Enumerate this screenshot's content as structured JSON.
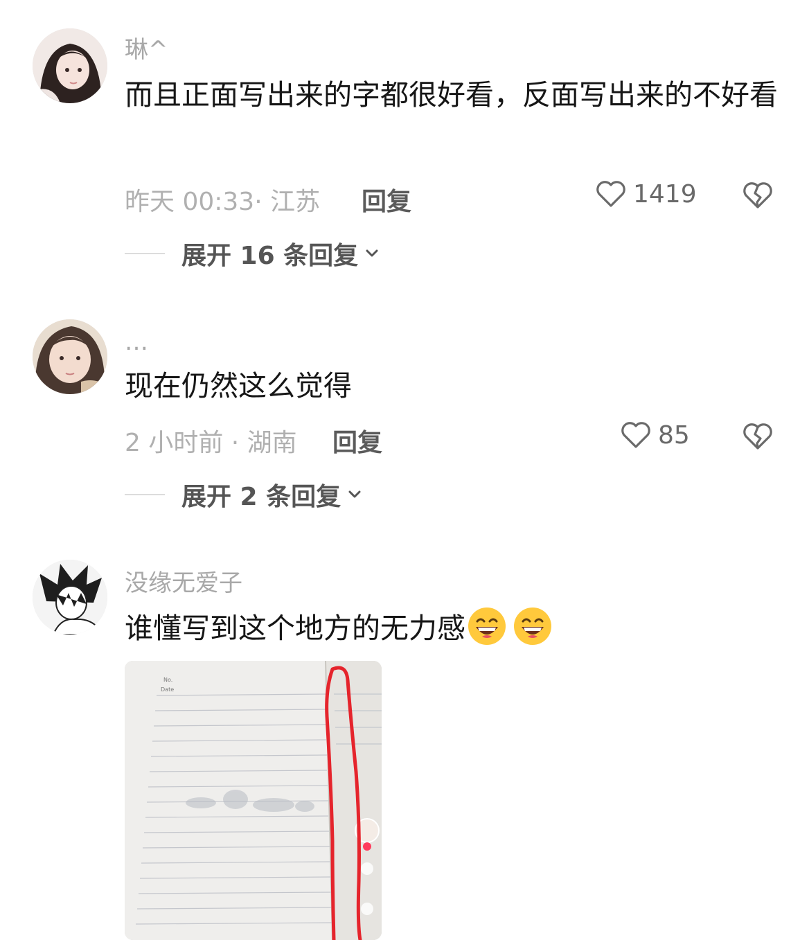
{
  "comments": [
    {
      "username": "琳^",
      "text": "而且正面写出来的字都很好看，反面写出来的不好看",
      "time_location": "昨天 00:33· 江苏",
      "reply_label": "回复",
      "likes": "1419",
      "expand_label": "展开 16 条回复"
    },
    {
      "username": "…",
      "text": "现在仍然这么觉得",
      "time_location": "2 小时前 · 湖南",
      "reply_label": "回复",
      "likes": "85",
      "expand_label": "展开 2 条回复"
    },
    {
      "username": "没缘无爱子",
      "text": "谁懂写到这个地方的无力感",
      "emojis": [
        "grinning-face-icon",
        "grinning-face-icon"
      ],
      "attachment_labels": {
        "no": "No.",
        "date": "Date"
      }
    }
  ],
  "colors": {
    "username": "#a8a8a8",
    "text": "#161616",
    "meta": "#b0b0b0",
    "annotation_red": "#e5242c"
  }
}
